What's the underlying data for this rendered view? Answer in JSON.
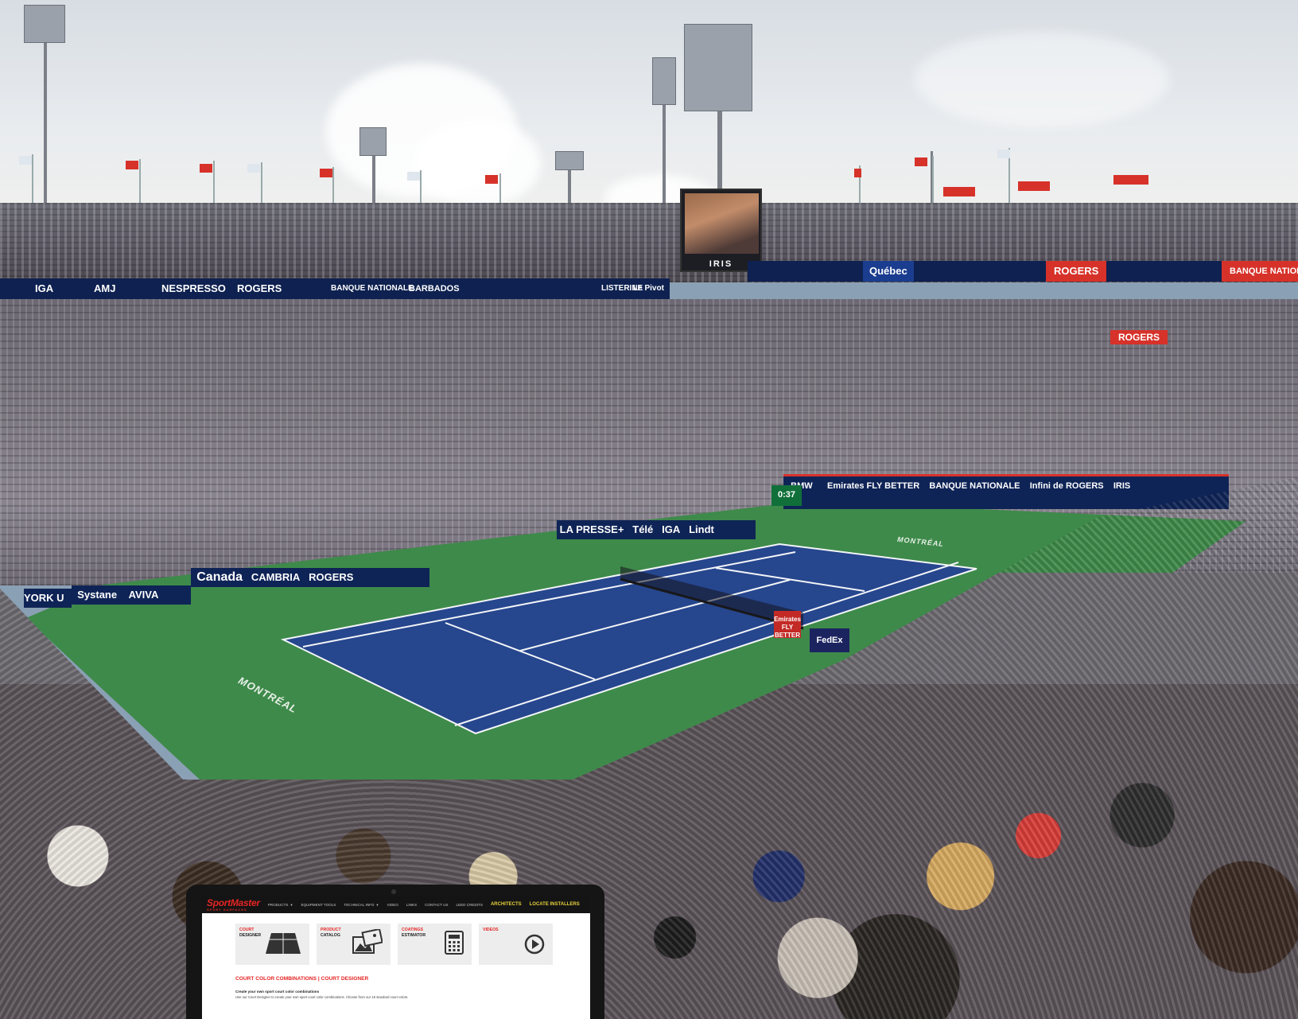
{
  "scene": {
    "scoreboard_label": "IRIS",
    "court_text_left": "MONTRÉAL",
    "court_text_top": "MONTRÉAL",
    "net_sponsor": "Emirates FLY BETTER",
    "fedex": "FedEx",
    "timer": "0:37",
    "upper_banner": [
      "IGA",
      "AMJ",
      "NESPRESSO",
      "ROGERS",
      "BANQUE NATIONALE",
      "BARBADOS",
      "LISTERINE",
      "Le Pivot"
    ],
    "right_banner": [
      "Québec",
      "ROGERS",
      "BANQUE NATIONALE"
    ],
    "mid_banner": "ROGERS",
    "dasher_left": [
      "YORK U",
      "Systane",
      "AVIVA",
      "Canada",
      "CAMBRIA",
      "ROGERS"
    ],
    "dasher_back": [
      "LA PRESSE+",
      "Télé",
      "IGA",
      "Lindt"
    ],
    "dasher_right": [
      "BMW",
      "Emirates FLY BETTER",
      "BANQUE NATIONALE",
      "Infini de ROGERS",
      "IRIS"
    ],
    "colors": {
      "court": "#26468e",
      "surround": "#3e8a4a",
      "banner": "#0e2150",
      "brand_red": "#d6322a"
    }
  },
  "laptop": {
    "logo": "SportMaster",
    "logo_tag": "SPORT SURFACES",
    "nav": [
      {
        "label": "PRODUCTS",
        "caret": "▼"
      },
      {
        "label": "EQUIPMENT TOOLS",
        "caret": ""
      },
      {
        "label": "TECHNICAL INFO",
        "caret": "▼"
      },
      {
        "label": "VIDEO",
        "caret": ""
      },
      {
        "label": "LINKS",
        "caret": ""
      },
      {
        "label": "CONTACT US",
        "caret": ""
      },
      {
        "label": "LEED CREDITS",
        "caret": ""
      }
    ],
    "nav_highlight": [
      "ARCHITECTS",
      "LOCATE INSTALLERS"
    ],
    "tiles": [
      {
        "line1": "COURT",
        "line2": "DESIGNER",
        "icon": "court-icon"
      },
      {
        "line1": "PRODUCT",
        "line2": "CATALOG",
        "icon": "images-icon"
      },
      {
        "line1": "COATINGS",
        "line2": "ESTIMATOR",
        "icon": "calculator-icon"
      },
      {
        "line1": "VIDEOS",
        "line2": "",
        "icon": "play-icon"
      }
    ],
    "section_heading": "COURT COLOR COMBINATIONS | COURT DESIGNER",
    "section_sub": "Create your own sport court color combinations",
    "section_body": "Use our Court Designer to create your own sport court color combinations. Choose from our 18 standard court colors.",
    "colors": {
      "accent": "#e52524",
      "highlight": "#e7d23c",
      "nav_bg": "#141414"
    }
  }
}
